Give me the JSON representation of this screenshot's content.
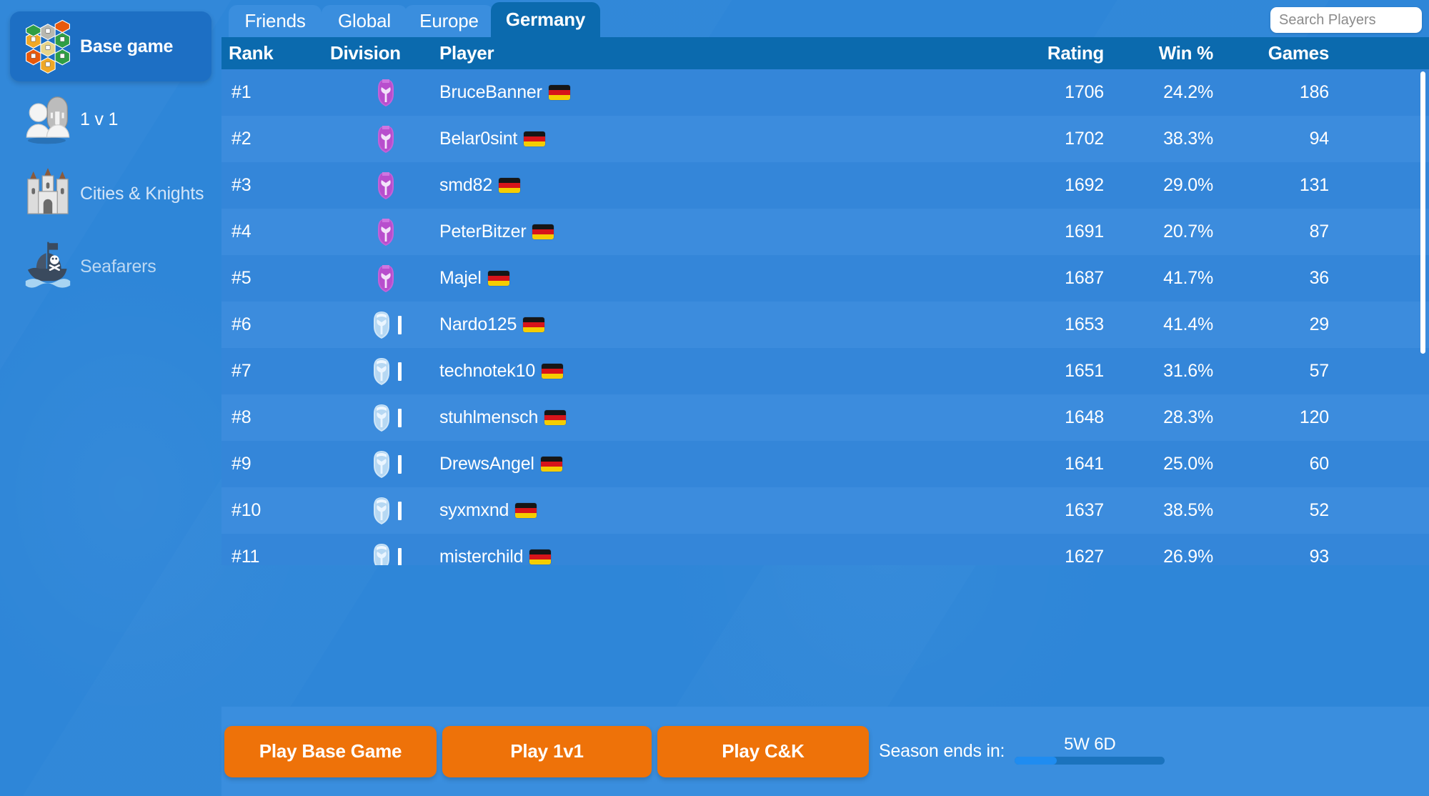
{
  "sidebar": {
    "items": [
      {
        "label": "Base game",
        "icon": "catan-board-icon",
        "active": true
      },
      {
        "label": "1 v 1",
        "icon": "two-players-icon",
        "active": false
      },
      {
        "label": "Cities & Knights",
        "icon": "castle-icon",
        "active": false
      },
      {
        "label": "Seafarers",
        "icon": "pirate-ship-icon",
        "active": false
      }
    ]
  },
  "tabs": [
    {
      "label": "Friends",
      "active": false
    },
    {
      "label": "Global",
      "active": false
    },
    {
      "label": "Europe",
      "active": false
    },
    {
      "label": "Germany",
      "active": true
    }
  ],
  "search": {
    "placeholder": "Search Players",
    "value": "",
    "icon": "search-icon"
  },
  "table": {
    "columns": [
      "Rank",
      "Division",
      "Player",
      "Rating",
      "Win %",
      "Games"
    ],
    "rows": [
      {
        "rank": "#1",
        "division": "purple-helmet",
        "tally": "",
        "player": "BruceBanner",
        "flag": "DE",
        "rating": "1706",
        "win": "24.2%",
        "games": "186"
      },
      {
        "rank": "#2",
        "division": "purple-helmet",
        "tally": "",
        "player": "Belar0sint",
        "flag": "DE",
        "rating": "1702",
        "win": "38.3%",
        "games": "94"
      },
      {
        "rank": "#3",
        "division": "purple-helmet",
        "tally": "",
        "player": "smd82",
        "flag": "DE",
        "rating": "1692",
        "win": "29.0%",
        "games": "131"
      },
      {
        "rank": "#4",
        "division": "purple-helmet",
        "tally": "",
        "player": "PeterBitzer",
        "flag": "DE",
        "rating": "1691",
        "win": "20.7%",
        "games": "87"
      },
      {
        "rank": "#5",
        "division": "purple-helmet",
        "tally": "",
        "player": "Majel",
        "flag": "DE",
        "rating": "1687",
        "win": "41.7%",
        "games": "36"
      },
      {
        "rank": "#6",
        "division": "silver-helmet",
        "tally": "I",
        "player": "Nardo125",
        "flag": "DE",
        "rating": "1653",
        "win": "41.4%",
        "games": "29"
      },
      {
        "rank": "#7",
        "division": "silver-helmet",
        "tally": "I",
        "player": "technotek10",
        "flag": "DE",
        "rating": "1651",
        "win": "31.6%",
        "games": "57"
      },
      {
        "rank": "#8",
        "division": "silver-helmet",
        "tally": "I",
        "player": "stuhlmensch",
        "flag": "DE",
        "rating": "1648",
        "win": "28.3%",
        "games": "120"
      },
      {
        "rank": "#9",
        "division": "silver-helmet",
        "tally": "I",
        "player": "DrewsAngel",
        "flag": "DE",
        "rating": "1641",
        "win": "25.0%",
        "games": "60"
      },
      {
        "rank": "#10",
        "division": "silver-helmet",
        "tally": "I",
        "player": "syxmxnd",
        "flag": "DE",
        "rating": "1637",
        "win": "38.5%",
        "games": "52"
      },
      {
        "rank": "#11",
        "division": "silver-helmet",
        "tally": "I",
        "player": "misterchild",
        "flag": "DE",
        "rating": "1627",
        "win": "26.9%",
        "games": "93"
      }
    ]
  },
  "bottom": {
    "play_base_label": "Play Base Game",
    "play_1v1_label": "Play 1v1",
    "play_ck_label": "Play C&K",
    "season_label": "Season ends in:",
    "season_time": "5W 6D",
    "season_progress_percent": 28
  },
  "colors": {
    "background": "#2e86d8",
    "panel_row": "#3486d9",
    "panel_row_alt": "#3c8cdd",
    "header_bar": "#0b6aae",
    "tab_inactive": "#3a8ede",
    "sidebar_active": "#1d6fc4",
    "accent_orange": "#ee7209",
    "progress_fill": "#1f8cf0",
    "progress_track": "#1b73bd"
  }
}
